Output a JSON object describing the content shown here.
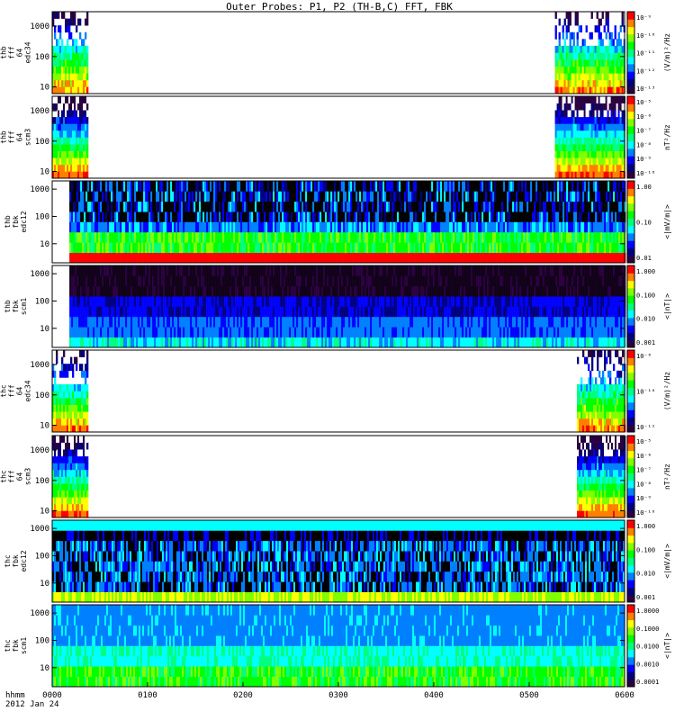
{
  "title": "Outer Probes: P1, P2 (TH-B,C) FFT, FBK",
  "time_axis": {
    "row1_label": "hhmm",
    "row2_label": "2012 Jan 24",
    "ticks": [
      "0000",
      "0100",
      "0200",
      "0300",
      "0400",
      "0500",
      "0600"
    ]
  },
  "colors": {
    "spectrum": [
      "#2a0040",
      "#000080",
      "#0000ff",
      "#0080ff",
      "#00ffff",
      "#00ff80",
      "#00ff00",
      "#80ff00",
      "#ffff00",
      "#ff8000",
      "#ff0000"
    ]
  },
  "chart_data": [
    {
      "type": "heatmap",
      "ylabel": [
        "thb",
        "fff",
        "64",
        "edc34"
      ],
      "yticks": [
        "1000",
        "100",
        "10"
      ],
      "ylog": [
        6,
        3000
      ],
      "cbar_label": "(V/m)²/Hz",
      "cbar_ticks": [
        "10⁻⁹",
        "10⁻¹⁰",
        "10⁻¹¹",
        "10⁻¹²",
        "10⁻¹³"
      ],
      "coverage": [
        [
          0,
          0.37
        ],
        [
          5.27,
          6.0
        ]
      ],
      "style": "fff"
    },
    {
      "type": "heatmap",
      "ylabel": [
        "thb",
        "fff",
        "64",
        "scm3"
      ],
      "yticks": [
        "1000",
        "100",
        "10"
      ],
      "ylog": [
        6,
        3000
      ],
      "cbar_label": "nT²/Hz",
      "cbar_ticks": [
        "10⁻⁵",
        "10⁻⁶",
        "10⁻⁷",
        "10⁻⁸",
        "10⁻⁹",
        "10⁻¹⁰"
      ],
      "coverage": [
        [
          0,
          0.37
        ],
        [
          5.27,
          6.0
        ]
      ],
      "style": "scm"
    },
    {
      "type": "heatmap",
      "ylabel": [
        "thb",
        "fbk",
        "edc12"
      ],
      "yticks": [
        "1000",
        "100",
        "10"
      ],
      "ylog": [
        2,
        2000
      ],
      "cbar_label": "<|mV/m|>",
      "cbar_ticks": [
        "1.00",
        "0.10",
        "0.01"
      ],
      "coverage": [
        [
          0.18,
          6.0
        ]
      ],
      "style": "fbk_e"
    },
    {
      "type": "heatmap",
      "ylabel": [
        "thb",
        "fbk",
        "scm1"
      ],
      "yticks": [
        "1000",
        "100",
        "10"
      ],
      "ylog": [
        2,
        2000
      ],
      "cbar_label": "<|nT|>",
      "cbar_ticks": [
        "1.000",
        "0.100",
        "0.010",
        "0.001"
      ],
      "coverage": [
        [
          0.18,
          6.0
        ]
      ],
      "style": "fbk_b"
    },
    {
      "type": "heatmap",
      "ylabel": [
        "thc",
        "fff",
        "64",
        "edc34"
      ],
      "yticks": [
        "1000",
        "100",
        "10"
      ],
      "ylog": [
        6,
        3000
      ],
      "cbar_label": "(V/m)²/Hz",
      "cbar_ticks": [
        "10⁻⁸",
        "10⁻¹⁰",
        "10⁻¹²"
      ],
      "coverage": [
        [
          0,
          0.37
        ],
        [
          5.5,
          6.0
        ]
      ],
      "style": "fff"
    },
    {
      "type": "heatmap",
      "ylabel": [
        "thc",
        "fff",
        "64",
        "scm3"
      ],
      "yticks": [
        "1000",
        "100",
        "10"
      ],
      "ylog": [
        6,
        3000
      ],
      "cbar_label": "nT²/Hz",
      "cbar_ticks": [
        "10⁻⁵",
        "10⁻⁶",
        "10⁻⁷",
        "10⁻⁸",
        "10⁻⁹",
        "10⁻¹⁰"
      ],
      "coverage": [
        [
          0,
          0.37
        ],
        [
          5.5,
          6.0
        ]
      ],
      "style": "scm"
    },
    {
      "type": "heatmap",
      "ylabel": [
        "thc",
        "fbk",
        "edc12"
      ],
      "yticks": [
        "1000",
        "100",
        "10"
      ],
      "ylog": [
        2,
        2000
      ],
      "cbar_label": "<|mV/m|>",
      "cbar_ticks": [
        "1.000",
        "0.100",
        "0.010",
        "0.001"
      ],
      "coverage": [
        [
          0,
          6.0
        ]
      ],
      "style": "fbk_e2"
    },
    {
      "type": "heatmap",
      "ylabel": [
        "thc",
        "fbk",
        "scm1"
      ],
      "yticks": [
        "1000",
        "100",
        "10"
      ],
      "ylog": [
        2,
        2000
      ],
      "cbar_label": "<|nT|>",
      "cbar_ticks": [
        "1.0000",
        "0.1000",
        "0.0100",
        "0.0010",
        "0.0001"
      ],
      "coverage": [
        [
          0,
          6.0
        ]
      ],
      "style": "fbk_b2"
    }
  ]
}
